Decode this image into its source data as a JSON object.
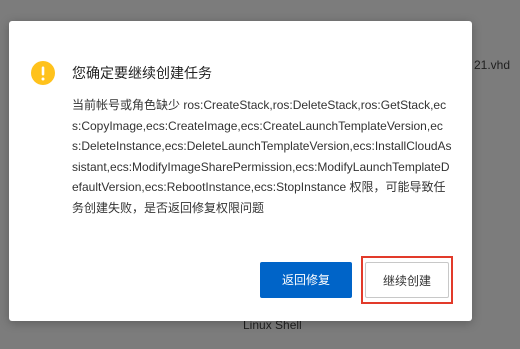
{
  "background": {
    "file_name_fragment": "21.vhd",
    "bottom_label": "Linux Shell"
  },
  "dialog": {
    "icon": "warning-icon",
    "title": "您确定要继续创建任务",
    "message": "当前帐号或角色缺少 ros:CreateStack,ros:DeleteStack,ros:GetStack,ecs:CopyImage,ecs:CreateImage,ecs:CreateLaunchTemplateVersion,ecs:DeleteInstance,ecs:DeleteLaunchTemplateVersion,ecs:InstallCloudAssistant,ecs:ModifyImageSharePermission,ecs:ModifyLaunchTemplateDefaultVersion,ecs:RebootInstance,ecs:StopInstance 权限，可能导致任务创建失败，是否返回修复权限问题",
    "primary_button": "返回修复",
    "secondary_button": "继续创建"
  },
  "colors": {
    "primary": "#0064c8",
    "warning": "#ffc21c",
    "highlight": "#e23a2a",
    "overlay": "#7c7c7c"
  }
}
